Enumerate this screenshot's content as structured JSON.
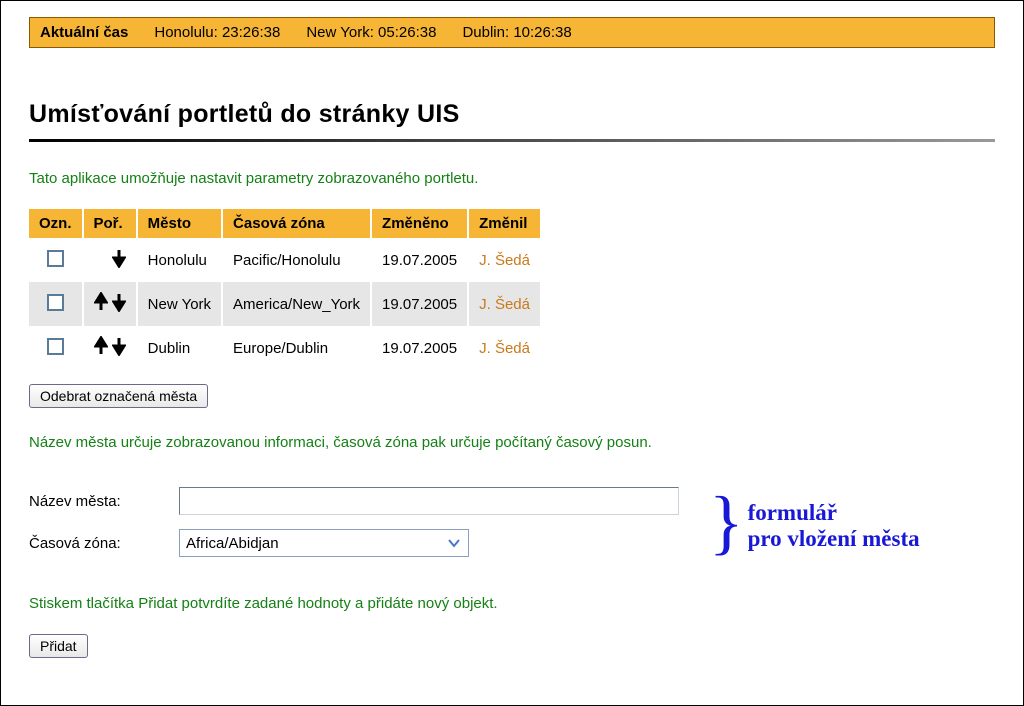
{
  "timebar": {
    "label": "Aktuální čas",
    "cities": [
      {
        "name": "Honolulu",
        "time": "23:26:38"
      },
      {
        "name": "New York",
        "time": "05:26:38"
      },
      {
        "name": "Dublin",
        "time": "10:26:38"
      }
    ]
  },
  "heading": "Umísťování portletů do stránky UIS",
  "intro": "Tato aplikace umožňuje nastavit parametry zobrazovaného portletu.",
  "table": {
    "headers": {
      "ozn": "Ozn.",
      "por": "Poř.",
      "mesto": "Město",
      "zona": "Časová zóna",
      "zmeneno": "Změněno",
      "zmenil": "Změnil"
    },
    "rows": [
      {
        "up": false,
        "down": true,
        "city": "Honolulu",
        "zone": "Pacific/Honolulu",
        "date": "19.07.2005",
        "by": "J. Šedá"
      },
      {
        "up": true,
        "down": true,
        "city": "New York",
        "zone": "America/New_York",
        "date": "19.07.2005",
        "by": "J. Šedá"
      },
      {
        "up": true,
        "down": true,
        "city": "Dublin",
        "zone": "Europe/Dublin",
        "date": "19.07.2005",
        "by": "J. Šedá"
      }
    ]
  },
  "remove_button": "Odebrat označená města",
  "hint": "Název města určuje zobrazovanou informaci, časová zóna pak určuje počítaný časový posun.",
  "form": {
    "name_label": "Název města:",
    "name_value": "",
    "zone_label": "Časová zóna:",
    "zone_selected": "Africa/Abidjan"
  },
  "annotation": {
    "line1": "formulář",
    "line2": "pro vložení města"
  },
  "confirm_text": "Stiskem tlačítka Přidat potvrdíte zadané hodnoty a přidáte nový objekt.",
  "add_button": "Přidat"
}
